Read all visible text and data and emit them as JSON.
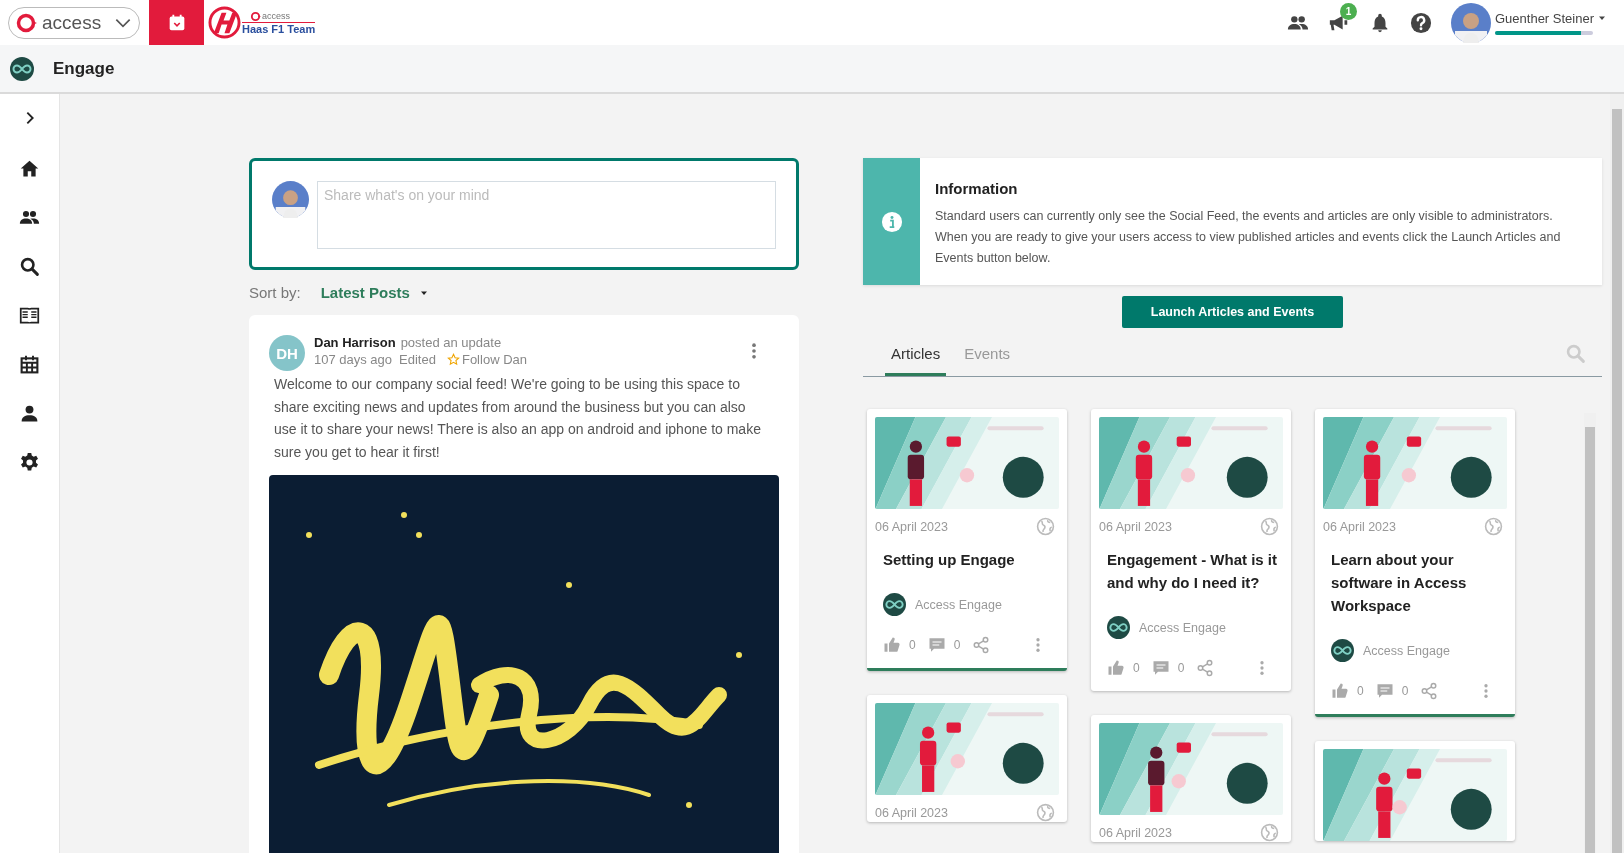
{
  "top_bar": {
    "brand": "access",
    "team_logo": {
      "label": "access",
      "team": "Haas F1 Team"
    },
    "notification_count": "1",
    "user": {
      "name": "Guenther Steiner",
      "level": 0.88
    }
  },
  "app_bar": {
    "title": "Engage"
  },
  "composer": {
    "placeholder": "Share what's on your mind"
  },
  "sort": {
    "label": "Sort by:",
    "value": "Latest Posts"
  },
  "post": {
    "initials": "DH",
    "author": "Dan Harrison",
    "action": "posted an update",
    "time": "107 days ago",
    "edited": "Edited",
    "follow": "Follow Dan",
    "body": "Welcome to our company social feed! We're going to be using this space to share exciting news and updates from around the business but you can also use it to share your news! There is also an app on android and iphone to make sure you get to hear it first!"
  },
  "info": {
    "title": "Information",
    "text": "Standard users can currently only see the Social Feed, the events and articles are only visible to administrators. When you are ready to give your users access to view published articles and events click the Launch Articles and Events button below."
  },
  "launch_button": "Launch Articles and Events",
  "tabs": [
    {
      "label": "Articles",
      "selected": true
    },
    {
      "label": "Events",
      "selected": false
    }
  ],
  "articles": [
    {
      "image": {
        "kind": "picture"
      },
      "date": "06 April 2023",
      "title": "Setting up Engage",
      "source": "Access Engage",
      "likes": "0",
      "comments": "0",
      "accent": true
    },
    {
      "image": {
        "kind": "picture"
      },
      "date": "06 April 2023",
      "title": "Engagement - What is it and why do I need it?",
      "source": "Access Engage",
      "likes": "0",
      "comments": "0",
      "accent": false
    },
    {
      "image": {
        "kind": "picture"
      },
      "date": "06 April 2023",
      "title": "Learn about your software in Access Workspace",
      "source": "Access Engage",
      "likes": "0",
      "comments": "0",
      "accent": true
    },
    {
      "image": {
        "kind": "picture"
      },
      "date": "06 April 2023"
    },
    {
      "image": {
        "kind": "picture"
      },
      "date": "06 April 2023"
    },
    {
      "image": {
        "kind": "picture"
      }
    }
  ]
}
